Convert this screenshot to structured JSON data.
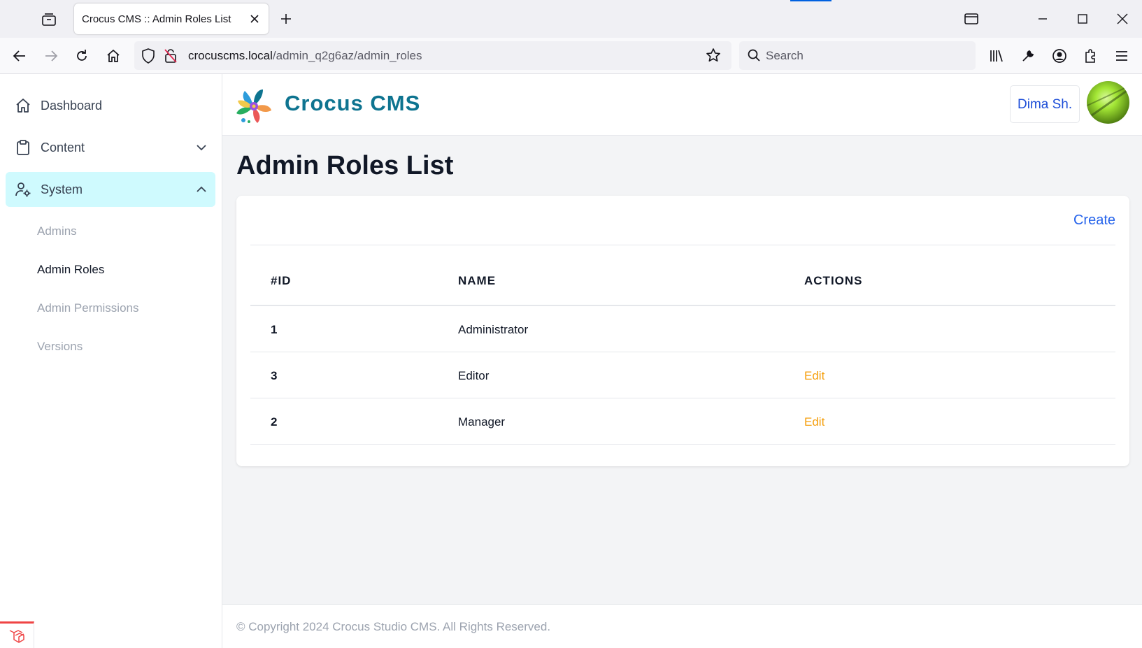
{
  "browser": {
    "tab_title": "Crocus CMS :: Admin Roles List",
    "url_host": "crocuscms.local",
    "url_path": "/admin_q2g6az/admin_roles",
    "search_placeholder": "Search"
  },
  "sidebar": {
    "items": [
      {
        "label": "Dashboard",
        "icon": "home-icon"
      },
      {
        "label": "Content",
        "icon": "clipboard-icon"
      },
      {
        "label": "System",
        "icon": "user-gear-icon"
      }
    ],
    "subitems": [
      {
        "label": "Admins"
      },
      {
        "label": "Admin Roles"
      },
      {
        "label": "Admin Permissions"
      },
      {
        "label": "Versions"
      }
    ]
  },
  "header": {
    "brand": "Crocus CMS",
    "user_name": "Dima Sh."
  },
  "page": {
    "title": "Admin Roles List",
    "create_label": "Create"
  },
  "table": {
    "headers": [
      "#ID",
      "NAME",
      "ACTIONS"
    ],
    "rows": [
      {
        "id": "1",
        "name": "Administrator",
        "action": ""
      },
      {
        "id": "3",
        "name": "Editor",
        "action": "Edit"
      },
      {
        "id": "2",
        "name": "Manager",
        "action": "Edit"
      }
    ]
  },
  "footer": {
    "text": "© Copyright 2024 Crocus Studio CMS. All Rights Reserved."
  },
  "colors": {
    "brand": "#0e7490",
    "active_bg": "#cffafe",
    "link": "#2563eb",
    "edit": "#f59e0b"
  }
}
